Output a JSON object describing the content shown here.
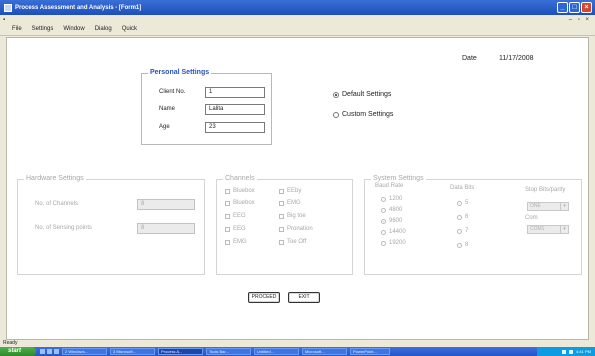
{
  "window": {
    "title": "Process Assessment and Analysis - [Form1]"
  },
  "menu": [
    "File",
    "Settings",
    "Window",
    "Dialog",
    "Quick"
  ],
  "date": {
    "label": "Date",
    "value": "11/17/2008"
  },
  "personal_settings": {
    "title": "Personal Settings",
    "fields": [
      {
        "label": "Client No.",
        "value": "1"
      },
      {
        "label": "Name",
        "value": "Lalita"
      },
      {
        "label": "Age",
        "value": "23"
      }
    ]
  },
  "mode": {
    "options": [
      "Default Settings",
      "Custom Settings"
    ],
    "selected": "Default Settings"
  },
  "hardware_settings": {
    "title": "Hardware Settings",
    "fields": [
      {
        "label": "No. of Channels",
        "value": "8"
      },
      {
        "label": "No. of Sensing points",
        "value": "8"
      }
    ]
  },
  "channels": {
    "title": "Channels",
    "col1": [
      "Bluebox",
      "Bluebox",
      "EEG",
      "EEG",
      "EMG"
    ],
    "col2": [
      "EEby",
      "EMG",
      "Big toe",
      "Pronation",
      "Toe Off"
    ]
  },
  "system_settings": {
    "title": "System Settings",
    "baud_rate": {
      "label": "Baud Rate",
      "options": [
        "1200",
        "4800",
        "9600",
        "14400",
        "19200"
      ],
      "selected": "9600"
    },
    "data_bits": {
      "label": "Data Bits",
      "options": [
        "5",
        "6",
        "7",
        "8"
      ]
    },
    "stop_bits": {
      "label": "Stop Bits/parity",
      "value": "ONE"
    },
    "com": {
      "label": "Com",
      "value": "COM1"
    }
  },
  "buttons": {
    "proceed": "PROCEED",
    "exit": "EXIT"
  },
  "status": {
    "text": "Ready"
  },
  "taskbar": {
    "start": "start",
    "tasks": [
      "2 Windows...",
      "3 Microsoft...",
      "Process A...",
      "Tools Bar...",
      "Untitled...",
      "Microsoft...",
      "PowerPoint..."
    ],
    "tray_time": "4:41 PM"
  }
}
